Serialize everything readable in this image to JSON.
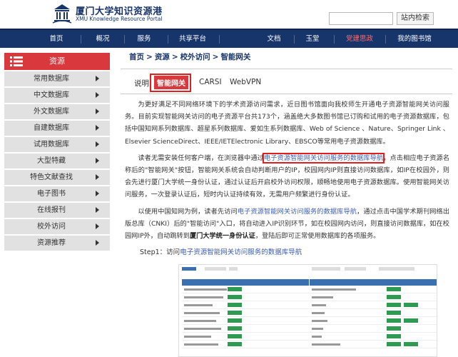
{
  "header": {
    "site_name_cn": "厦门大学知识资源港",
    "site_name_en": "XMU Knowledge Resource Portal",
    "search_placeholder": "",
    "search_button": "站内检索"
  },
  "nav": {
    "items": [
      {
        "label": "首页"
      },
      {
        "label": "概况"
      },
      {
        "label": "服务"
      },
      {
        "label": "共享平台"
      },
      {
        "label": "文档"
      },
      {
        "label": "玉堂"
      },
      {
        "label": "党建思政",
        "highlight": true
      },
      {
        "label": "我的图书馆"
      }
    ]
  },
  "sidebar": {
    "title": "资源",
    "items": [
      {
        "label": "常用数据库"
      },
      {
        "label": "中文数据库"
      },
      {
        "label": "外文数据库"
      },
      {
        "label": "自建数据库"
      },
      {
        "label": "试用数据库"
      },
      {
        "label": "大型特藏"
      },
      {
        "label": "特色文献查找"
      },
      {
        "label": "电子图书"
      },
      {
        "label": "在线报刊"
      },
      {
        "label": "校外访问"
      },
      {
        "label": "资源推荐"
      }
    ]
  },
  "breadcrumb": [
    "首页",
    "资源",
    "校外访问",
    "智能网关"
  ],
  "tabs": [
    {
      "label": "说明"
    },
    {
      "label": "智能网关",
      "active": true
    },
    {
      "label": "CARSI"
    },
    {
      "label": "WebVPN"
    }
  ],
  "content": {
    "p1": "为更好满足不同网络环境下的学术资源访问需求，近日图书馆面向我校师生开通电子资源智能网关访问服务。目前实现智能网关访问的电子资源平台共173个，涵盖绝大多数图书馆已订购和试用的电子资源数据库，包括中国知网系列数据库、超星系列数据库、爱如生系列数据库、Web of Science 、Nature、Springer Link 、Elsevier ScienceDirect、IEEE/IETElectronic Library、EBSCO等常用电子资源数据库。",
    "p2_a": "读者无需安装任何客户端，在浏览器中通过",
    "p2_link": "电子资源智能网关访问服务的数据库导航",
    "p2_b": "，点击相应电子资源名称后的\"智能网关\"按钮，智能网关系统会自动判断用户的IP，校园网内IP则直接访问数据库，如IP在校园外，则会先进行厦门大学统一身份认证，通过认证后开启校外访问权限，顺畅地使用电子资源数据库。使用智能网关访问服务，一次登录认证后，短时内认证持续有效，无需用户频繁进行身份认证。",
    "p3_a": "以使用中国知网为例，读者先访问",
    "p3_link": "电子资源智能网关访问服务的数据库导航",
    "p3_b": "，通过点击中国学术期刊网络出版总库（CNKI）后的\"智能访问\"入口，将自动进入IP识别环节，如在校园网内访问，则直接访问数据库，如在校园网IP外，自动跳转到",
    "p3_bold": "厦门大学统一身份认证",
    "p3_c": "，登陆后即可正常使用数据库的各项服务。",
    "step1_a": "Step1：访问",
    "step1_link": "电子资源智能网关访问服务的数据库导航"
  },
  "colors": {
    "nav_bg": "#17356b",
    "accent_red": "#d9383d",
    "link_blue": "#3a5cb3",
    "highlight_box": "#e02020"
  }
}
